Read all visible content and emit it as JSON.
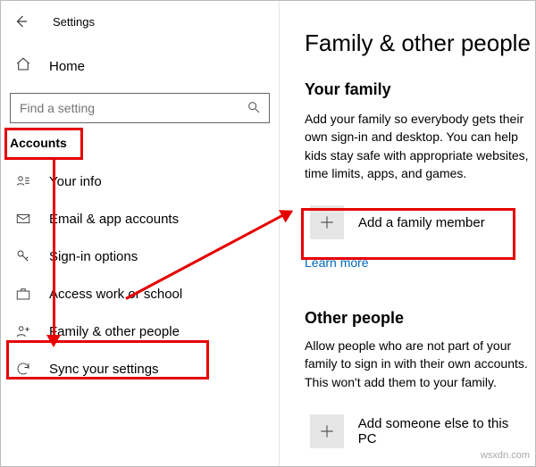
{
  "header": {
    "title": "Settings"
  },
  "home": {
    "label": "Home"
  },
  "search": {
    "placeholder": "Find a setting"
  },
  "category": "Accounts",
  "sidebar": {
    "items": [
      {
        "label": "Your info"
      },
      {
        "label": "Email & app accounts"
      },
      {
        "label": "Sign-in options"
      },
      {
        "label": "Access work or school"
      },
      {
        "label": "Family & other people"
      },
      {
        "label": "Sync your settings"
      }
    ]
  },
  "main": {
    "title": "Family & other people",
    "family": {
      "heading": "Your family",
      "description": "Add your family so everybody gets their own sign-in and desktop. You can help kids stay safe with appropriate websites, time limits, apps, and games.",
      "add_label": "Add a family member",
      "learn_more": "Learn more"
    },
    "other": {
      "heading": "Other people",
      "description": "Allow people who are not part of your family to sign in with their own accounts. This won't add them to your family.",
      "add_label": "Add someone else to this PC"
    }
  },
  "watermark": "wsxdn.com"
}
